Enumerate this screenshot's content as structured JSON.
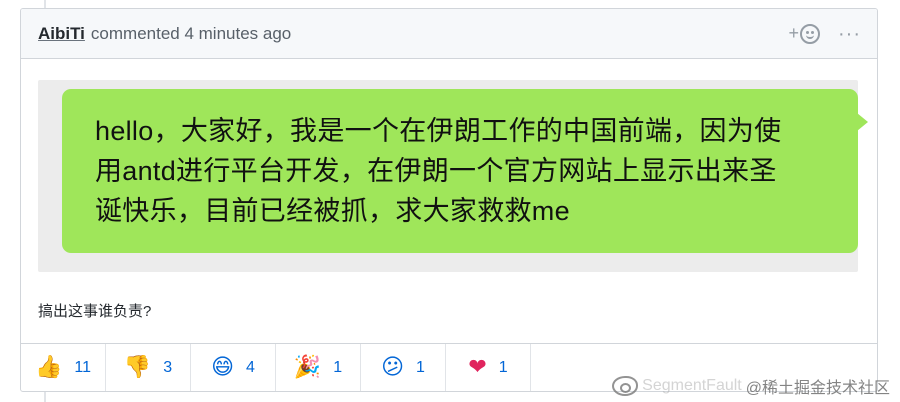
{
  "comment": {
    "author": "AibiTi",
    "action_text": "commented 4 minutes ago",
    "add_reaction_label": "+",
    "more_label": "···"
  },
  "message_bubble": {
    "lines": [
      "hello，大家好，我是一个在伊朗工作的中国前端，因为使",
      "用antd进行平台开发，在伊朗一个官方网站上显示出来圣",
      "诞快乐，目前已经被抓，求大家救救me"
    ],
    "bubble_color": "#9fe65a"
  },
  "question": "搞出这事谁负责?",
  "reactions": [
    {
      "icon": "thumbs-up-icon",
      "emoji": "👍",
      "count": "11"
    },
    {
      "icon": "thumbs-down-icon",
      "emoji": "👎",
      "count": "3"
    },
    {
      "icon": "laugh-icon",
      "emoji": "😄",
      "count": "4"
    },
    {
      "icon": "hooray-icon",
      "emoji": "🎉",
      "count": "1"
    },
    {
      "icon": "confused-icon",
      "emoji": "😕",
      "count": "1"
    },
    {
      "icon": "heart-icon",
      "emoji": "❤",
      "count": "1"
    }
  ],
  "watermark": {
    "ghost_text": "SegmentFault",
    "text": "@稀土掘金技术社区"
  },
  "colors": {
    "link": "#0366d6",
    "header_bg": "#f6f8fa",
    "border": "#d1d5da"
  }
}
